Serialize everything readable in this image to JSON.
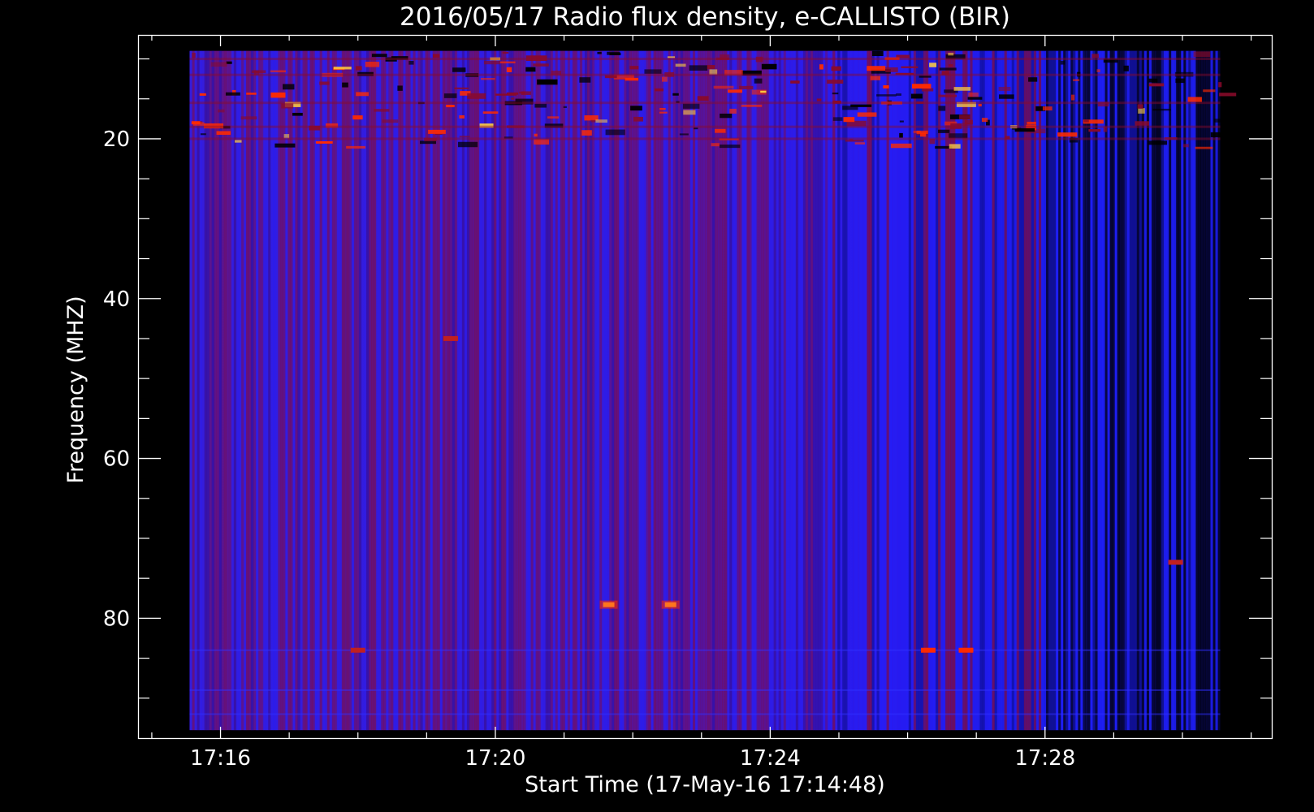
{
  "chart_data": {
    "type": "heatmap",
    "title": "2016/05/17  Radio flux density, e-CALLISTO (BIR)",
    "xlabel": "Start Time (17-May-16 17:14:48)",
    "ylabel": "Frequency (MHZ)",
    "x_ticks": [
      "17:16",
      "17:20",
      "17:24",
      "17:28"
    ],
    "x_tick_minutes": [
      16,
      20,
      24,
      28
    ],
    "y_ticks": [
      "20",
      "40",
      "60",
      "80"
    ],
    "y_tick_values": [
      20,
      40,
      60,
      80
    ],
    "xlim_minutes": [
      14.8,
      31.3
    ],
    "ylim_mhz": [
      95,
      7
    ],
    "data_time_range_minutes": [
      15.55,
      30.55
    ],
    "data_freq_range_mhz": [
      9,
      94
    ],
    "colormap": [
      "#000000",
      "#2020ff",
      "#8a0a2a",
      "#ff2a00",
      "#ffd040"
    ],
    "background_color": "#000000",
    "axis_color": "#ffffff",
    "quiet_sun_level": "blue",
    "interference_bands_mhz": [
      10,
      12,
      15.5,
      18.5,
      20
    ],
    "bursts": [
      {
        "time_min": 21.65,
        "freq_mhz": 78.3,
        "intensity": "high"
      },
      {
        "time_min": 22.55,
        "freq_mhz": 78.3,
        "intensity": "high"
      },
      {
        "time_min": 26.3,
        "freq_mhz": 84,
        "intensity": "medium"
      },
      {
        "time_min": 26.85,
        "freq_mhz": 84,
        "intensity": "medium"
      },
      {
        "time_min": 18.0,
        "freq_mhz": 84,
        "intensity": "low"
      },
      {
        "time_min": 19.35,
        "freq_mhz": 45,
        "intensity": "low"
      },
      {
        "time_min": 29.9,
        "freq_mhz": 73,
        "intensity": "low"
      }
    ]
  }
}
